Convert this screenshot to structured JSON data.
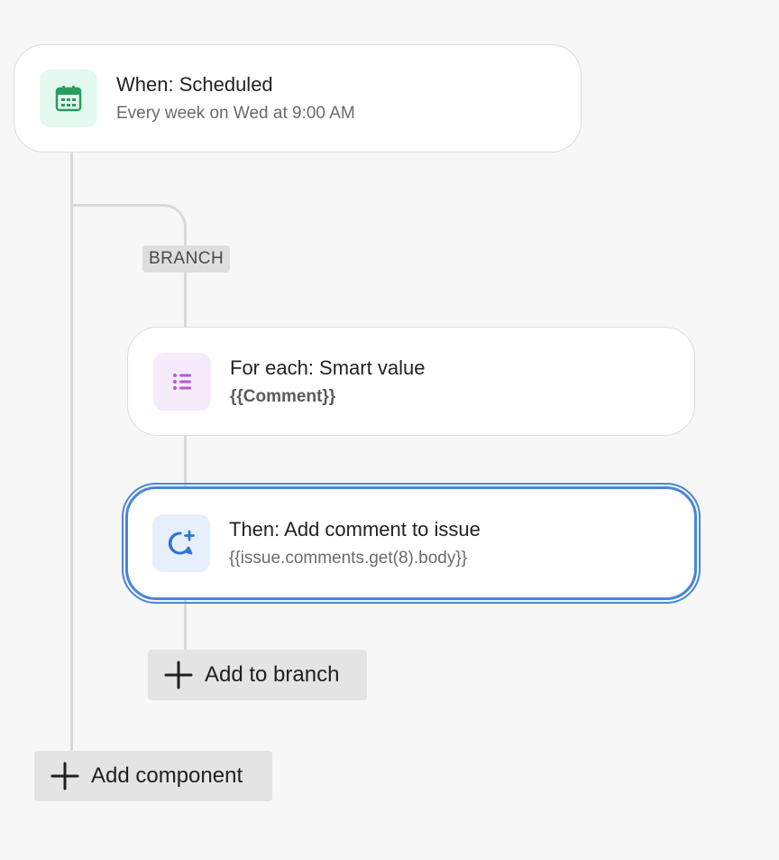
{
  "trigger": {
    "title": "When: Scheduled",
    "subtitle": "Every week on Wed at 9:00 AM",
    "icon": "calendar-icon",
    "icon_color": "#2a9b5f",
    "icon_bg": "#e3f8ee"
  },
  "branch": {
    "label": "BRANCH",
    "for_each": {
      "title": "For each: Smart value",
      "subtitle": "{{Comment}}",
      "icon": "list-icon",
      "icon_color": "#b75ad8",
      "icon_bg": "#f6ebfb"
    },
    "action": {
      "title": "Then: Add comment to issue",
      "subtitle": "{{issue.comments.get(8).body}}",
      "icon": "add-comment-icon",
      "icon_color": "#2f74d6",
      "icon_bg": "#e6effb"
    },
    "add_label": "Add to branch"
  },
  "add_component_label": "Add component",
  "colors": {
    "selection": "#4a86d9",
    "connector": "#d9d9d9"
  }
}
